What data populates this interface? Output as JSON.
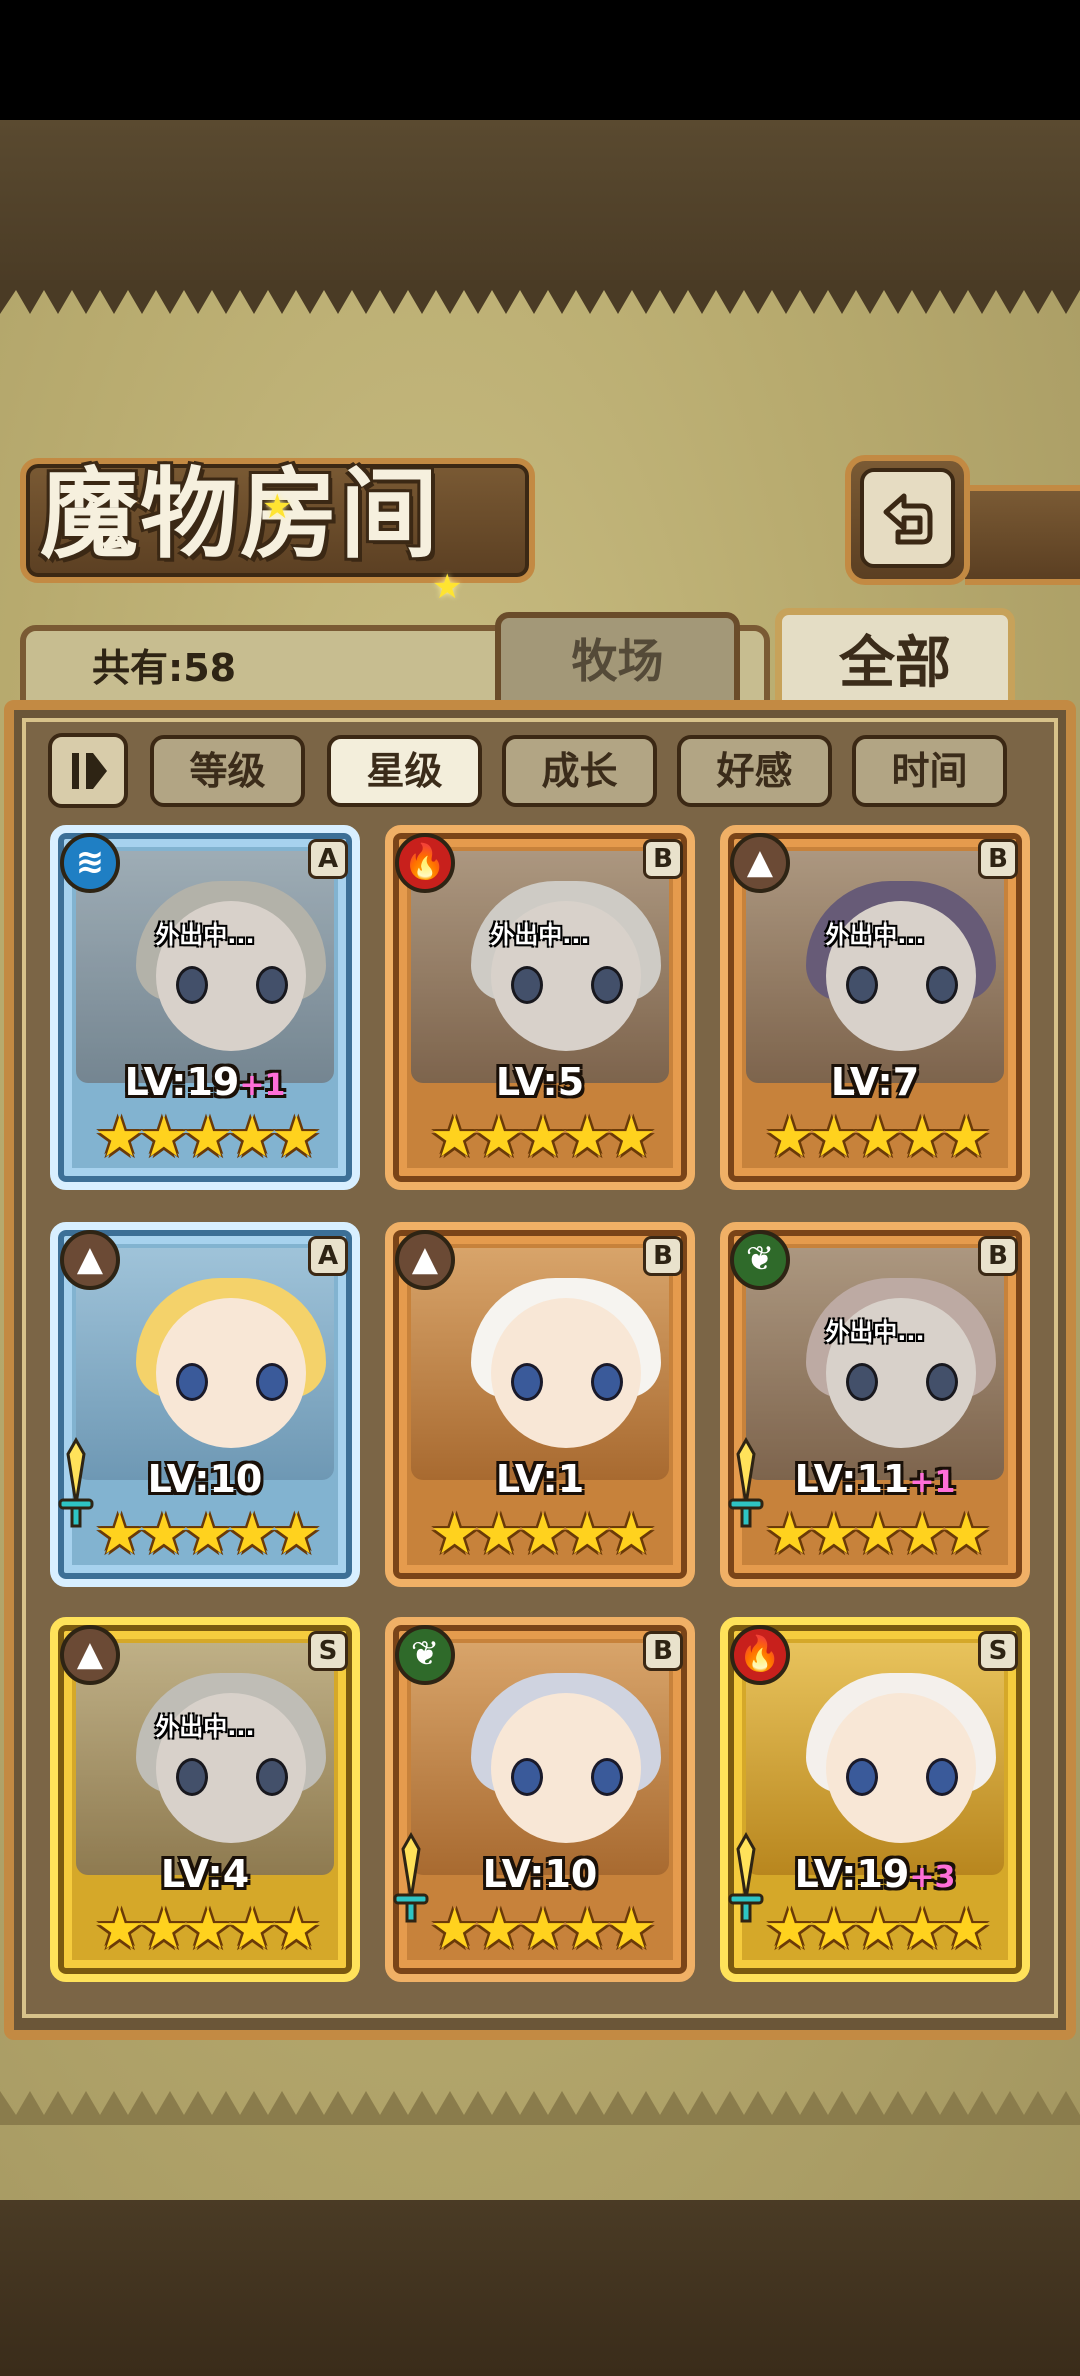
{
  "title": "魔物房间",
  "count_label": "共有:58",
  "tabs": {
    "farm": "牧场",
    "all": "全部"
  },
  "sort_toggle_icon": "sort-toggle-icon",
  "sort_buttons": [
    "等级",
    "星级",
    "成长",
    "好感",
    "时间"
  ],
  "active_sort": "星级",
  "away_text": "外出中...",
  "colors": {
    "blue_frame": "#82b3d0",
    "orange_frame": "#c7823b",
    "gold_frame": "#d5a829",
    "plus": "#ff6fd8",
    "star": "#ffd21e"
  },
  "cards": [
    {
      "frame": "blue",
      "element": "water",
      "rank": "A",
      "level": "LV:19",
      "plus": "+1",
      "stars": "★★★★★",
      "away": true,
      "weapon": false
    },
    {
      "frame": "orange",
      "element": "fire",
      "rank": "B",
      "level": "LV:5",
      "plus": "",
      "stars": "★★★★★",
      "away": true,
      "weapon": false
    },
    {
      "frame": "orange",
      "element": "earth",
      "rank": "B",
      "level": "LV:7",
      "plus": "",
      "stars": "★★★★★",
      "away": true,
      "weapon": false
    },
    {
      "frame": "blue",
      "element": "earth",
      "rank": "A",
      "level": "LV:10",
      "plus": "",
      "stars": "★★★★★",
      "away": false,
      "weapon": true
    },
    {
      "frame": "orange",
      "element": "earth",
      "rank": "B",
      "level": "LV:1",
      "plus": "",
      "stars": "★★★★★",
      "away": false,
      "weapon": false
    },
    {
      "frame": "orange",
      "element": "wood",
      "rank": "B",
      "level": "LV:11",
      "plus": "+1",
      "stars": "★★★★★",
      "away": true,
      "weapon": true
    },
    {
      "frame": "gold",
      "element": "earth",
      "rank": "S",
      "level": "LV:4",
      "plus": "",
      "stars": "★★★★★",
      "away": true,
      "weapon": false
    },
    {
      "frame": "orange",
      "element": "wood",
      "rank": "B",
      "level": "LV:10",
      "plus": "",
      "stars": "★★★★★",
      "away": false,
      "weapon": true
    },
    {
      "frame": "gold",
      "element": "fire",
      "rank": "S",
      "level": "LV:19",
      "plus": "+3",
      "stars": "★★★★★",
      "away": false,
      "weapon": true
    }
  ]
}
